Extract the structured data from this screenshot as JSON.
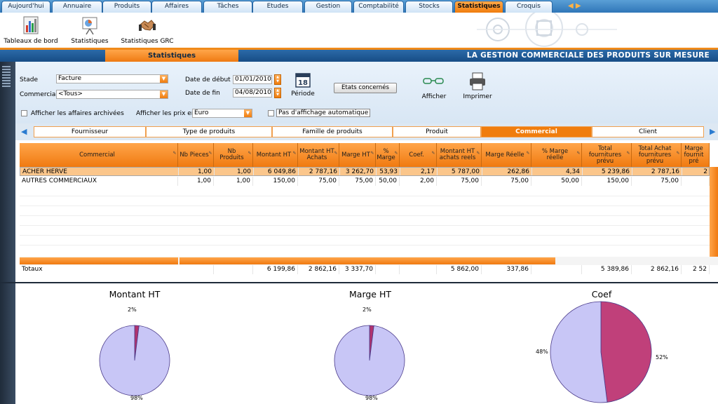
{
  "tabs": [
    {
      "label": "Aujourd'hui",
      "active": false
    },
    {
      "label": "Annuaire",
      "active": false
    },
    {
      "label": "Produits",
      "active": false
    },
    {
      "label": "Affaires",
      "active": false
    },
    {
      "label": "Tâches",
      "active": false
    },
    {
      "label": "Etudes",
      "active": false
    },
    {
      "label": "Gestion",
      "active": false
    },
    {
      "label": "Comptabilité",
      "active": false
    },
    {
      "label": "Stocks",
      "active": false
    },
    {
      "label": "Statistiques",
      "active": true
    },
    {
      "label": "Croquis",
      "active": false
    }
  ],
  "toolbar": {
    "dashboards_label": "Tableaux de bord",
    "statistics_label": "Statistiques",
    "grc_label": "Statistiques GRC"
  },
  "titlebar": {
    "section_title": "Statistiques",
    "brand_text": "LA GESTION COMMERCIALE DES PRODUITS SUR MESURE"
  },
  "filters": {
    "stade_label": "Stade",
    "stade_value": "Facture",
    "commercial_label": "Commercial",
    "commercial_value": "<Tous>",
    "date_start_label": "Date de début",
    "date_start_value": "01/01/2010",
    "date_end_label": "Date de fin",
    "date_end_value": "04/08/2010",
    "period_label": "Période",
    "calendar_day": "18",
    "states_button": "Etats concernés",
    "show_label": "Afficher",
    "print_label": "Imprimer",
    "archived_label": "Afficher les affaires archivées",
    "prices_label": "Afficher les prix en",
    "prices_value": "Euro",
    "auto_label": "Pas d'affichage automatique"
  },
  "subtabs": [
    {
      "label": "Fournisseur",
      "active": false
    },
    {
      "label": "Type de produits",
      "active": false
    },
    {
      "label": "Famille de produits",
      "active": false
    },
    {
      "label": "Produit",
      "active": false
    },
    {
      "label": "Commercial",
      "active": true
    },
    {
      "label": "Client",
      "active": false
    }
  ],
  "grid": {
    "columns": [
      "Commercial",
      "Nb Pieces",
      "Nb Produits",
      "Montant HT",
      "Montant HT Achats",
      "Marge HT",
      "% Marge",
      "Coef.",
      "Montant HT achats reels",
      "Marge Réelle",
      "% Marge réelle",
      "Total fournitures prévu",
      "Total Achat fournitures prévu",
      "Marge fournit pré"
    ],
    "rows": [
      {
        "selected": true,
        "cells": [
          "ACHER HERVE",
          "1,00",
          "1,00",
          "6 049,86",
          "2 787,16",
          "3 262,70",
          "53,93",
          "2,17",
          "5 787,00",
          "262,86",
          "4,34",
          "5 239,86",
          "2 787,16",
          "2"
        ]
      },
      {
        "selected": false,
        "cells": [
          "AUTRES COMMERCIAUX",
          "1,00",
          "1,00",
          "150,00",
          "75,00",
          "75,00",
          "50,00",
          "2,00",
          "75,00",
          "75,00",
          "50,00",
          "150,00",
          "75,00",
          ""
        ]
      }
    ],
    "totals": [
      "Totaux",
      "",
      "",
      "6 199,86",
      "2 862,16",
      "3 337,70",
      "",
      "",
      "5 862,00",
      "337,86",
      "",
      "5 389,86",
      "2 862,16",
      "2 52"
    ]
  },
  "chart_data": [
    {
      "type": "pie",
      "title": "Montant HT",
      "categories": [
        "",
        ""
      ],
      "values": [
        2,
        98
      ],
      "labels": [
        "2%",
        "98%"
      ],
      "colors": [
        "#b0336e",
        "#c8c6f6"
      ]
    },
    {
      "type": "pie",
      "title": "Marge HT",
      "categories": [
        "",
        ""
      ],
      "values": [
        2,
        98
      ],
      "labels": [
        "2%",
        "98%"
      ],
      "colors": [
        "#b0336e",
        "#c8c6f6"
      ]
    },
    {
      "type": "pie",
      "title": "Coef",
      "categories": [
        "",
        ""
      ],
      "values": [
        48,
        52
      ],
      "labels": [
        "48%",
        "52%"
      ],
      "colors": [
        "#c0407a",
        "#c8c6f6"
      ]
    }
  ]
}
